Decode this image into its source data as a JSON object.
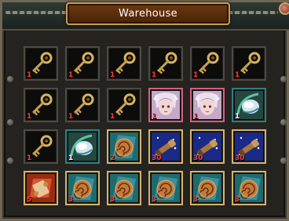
{
  "window": {
    "title": "Warehouse"
  },
  "colors": {
    "qty_red": "#ff3d2e",
    "qty_white": "#ffffff",
    "title_bg": "#5a2b0a",
    "frame": "#6f6654"
  },
  "items": [
    {
      "icon": "key-icon",
      "qty": "1"
    },
    {
      "icon": "key-icon",
      "qty": "1"
    },
    {
      "icon": "key-icon",
      "qty": "1"
    },
    {
      "icon": "key-icon",
      "qty": "1"
    },
    {
      "icon": "key-icon",
      "qty": "1"
    },
    {
      "icon": "key-icon",
      "qty": "1"
    },
    {
      "icon": "key-icon",
      "qty": "1"
    },
    {
      "icon": "key-icon",
      "qty": "1"
    },
    {
      "icon": "key-icon",
      "qty": "1"
    },
    {
      "icon": "fairy-portrait-icon",
      "qty": "1"
    },
    {
      "icon": "fairy-portrait-icon",
      "qty": "1"
    },
    {
      "icon": "crystal-orb-icon",
      "qty": "1"
    },
    {
      "icon": "key-icon",
      "qty": "1"
    },
    {
      "icon": "crystal-orb-icon",
      "qty": "1"
    },
    {
      "icon": "spiral-artifact-icon",
      "qty": "2"
    },
    {
      "icon": "telescope-icon",
      "qty": "30"
    },
    {
      "icon": "telescope-icon",
      "qty": "30"
    },
    {
      "icon": "telescope-icon",
      "qty": "30"
    },
    {
      "icon": "scroll-icon",
      "qty": "5"
    },
    {
      "icon": "spiral-artifact-icon",
      "qty": "3"
    },
    {
      "icon": "spiral-artifact-icon",
      "qty": "3"
    },
    {
      "icon": "spiral-artifact-icon",
      "qty": "3"
    },
    {
      "icon": "spiral-artifact-icon",
      "qty": "3"
    },
    {
      "icon": "spiral-artifact-icon",
      "qty": "3"
    }
  ]
}
